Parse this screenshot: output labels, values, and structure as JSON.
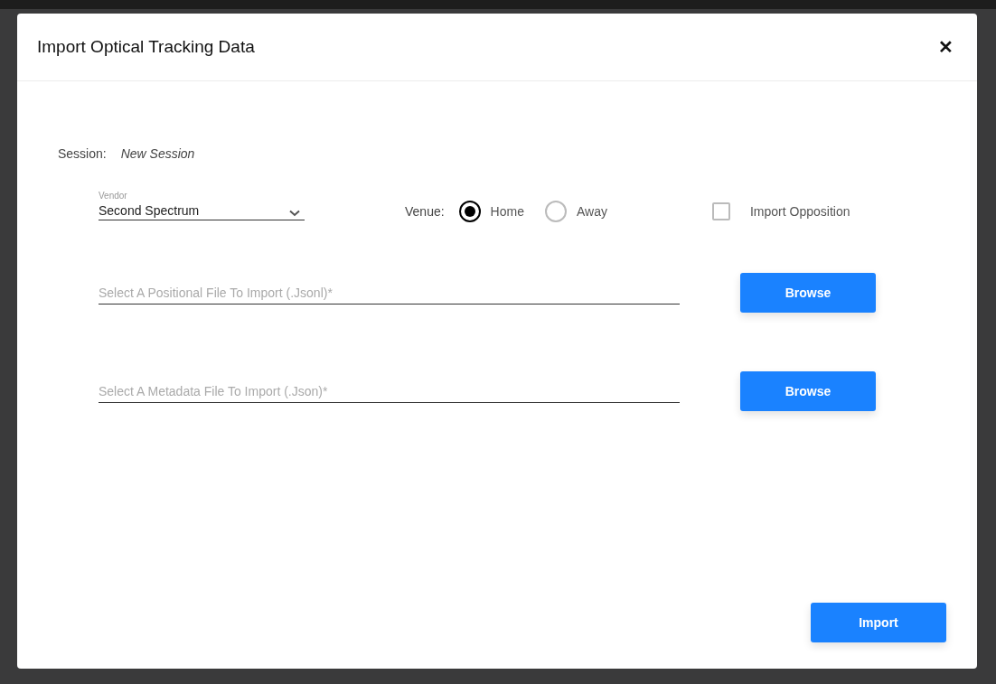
{
  "dialog": {
    "title": "Import Optical Tracking Data",
    "close_icon": "✕"
  },
  "session": {
    "label": "Session:",
    "value": "New Session"
  },
  "vendor": {
    "label": "Vendor",
    "value": "Second Spectrum"
  },
  "venue": {
    "label": "Venue:",
    "options": [
      {
        "label": "Home",
        "selected": true
      },
      {
        "label": "Away",
        "selected": false
      }
    ]
  },
  "import_opposition": {
    "label": "Import Opposition",
    "checked": false
  },
  "files": [
    {
      "placeholder": "Select A Positional File To Import (.Jsonl)*",
      "button": "Browse"
    },
    {
      "placeholder": "Select A Metadata File To Import (.Json)*",
      "button": "Browse"
    }
  ],
  "import_button": "Import"
}
